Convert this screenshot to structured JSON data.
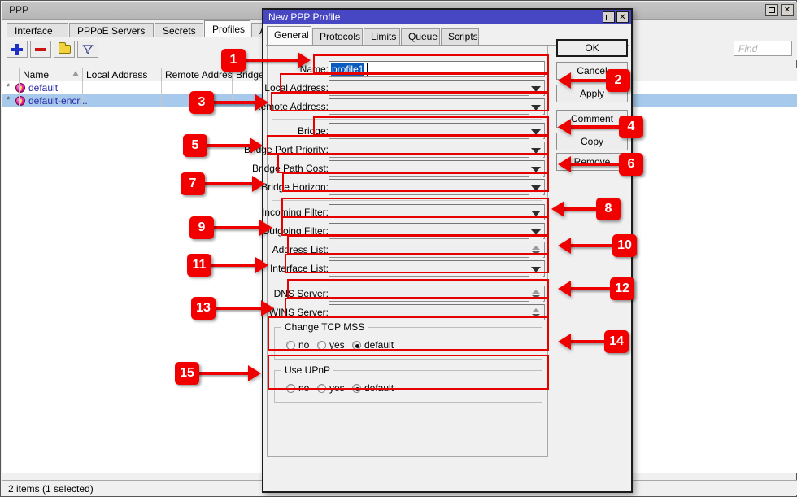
{
  "main_window": {
    "title": "PPP",
    "controls": {
      "maximize": "□",
      "close": "✕"
    },
    "tabs": [
      {
        "label": "Interface",
        "active": false
      },
      {
        "label": "PPPoE Servers",
        "active": false
      },
      {
        "label": "Secrets",
        "active": false
      },
      {
        "label": "Profiles",
        "active": true
      },
      {
        "label": "Active Connec",
        "active": false
      }
    ],
    "toolbar": [
      {
        "name": "add-button",
        "icon": "plus-icon"
      },
      {
        "name": "remove-button",
        "icon": "minus-icon"
      },
      {
        "name": "comment-button",
        "icon": "folder-icon"
      },
      {
        "name": "filter-button",
        "icon": "funnel-icon"
      }
    ],
    "find": {
      "placeholder": "Find",
      "value": ""
    },
    "list": {
      "columns": [
        "Name",
        "Local Address",
        "Remote Address",
        "Bridge"
      ],
      "rows": [
        {
          "flag": "*",
          "name": "default",
          "local_address": "",
          "remote_address": "",
          "bridge": "",
          "selected": false
        },
        {
          "flag": "*",
          "name": "default-encr...",
          "local_address": "",
          "remote_address": "",
          "bridge": "",
          "selected": true
        }
      ]
    },
    "status": "2 items (1 selected)"
  },
  "dialog": {
    "title": "New PPP Profile",
    "controls": {
      "maximize": "□",
      "close": "✕"
    },
    "tabs": [
      {
        "label": "General",
        "active": true
      },
      {
        "label": "Protocols",
        "active": false
      },
      {
        "label": "Limits",
        "active": false
      },
      {
        "label": "Queue",
        "active": false
      },
      {
        "label": "Scripts",
        "active": false
      }
    ],
    "fields": [
      {
        "label": "Name:",
        "value": "profile1",
        "selected_text": true,
        "control": "text"
      },
      {
        "label": "Local Address:",
        "value": "",
        "control": "dropdown"
      },
      {
        "label": "Remote Address:",
        "value": "",
        "control": "dropdown"
      },
      {
        "label": "Bridge:",
        "value": "",
        "control": "dropdown"
      },
      {
        "label": "Bridge Port Priority:",
        "value": "",
        "control": "dropdown"
      },
      {
        "label": "Bridge Path Cost:",
        "value": "",
        "control": "dropdown"
      },
      {
        "label": "Bridge Horizon:",
        "value": "",
        "control": "dropdown"
      },
      {
        "label": "Incoming Filter:",
        "value": "",
        "control": "dropdown"
      },
      {
        "label": "Outgoing Filter:",
        "value": "",
        "control": "dropdown"
      },
      {
        "label": "Address List:",
        "value": "",
        "control": "spinner"
      },
      {
        "label": "Interface List:",
        "value": "",
        "control": "dropdown"
      },
      {
        "label": "DNS Server:",
        "value": "",
        "control": "spinner"
      },
      {
        "label": "WINS Server:",
        "value": "",
        "control": "spinner"
      }
    ],
    "groups": [
      {
        "title": "Change TCP MSS",
        "options": [
          {
            "label": "no",
            "selected": false
          },
          {
            "label": "yes",
            "selected": false
          },
          {
            "label": "default",
            "selected": true
          }
        ]
      },
      {
        "title": "Use UPnP",
        "options": [
          {
            "label": "no",
            "selected": false
          },
          {
            "label": "yes",
            "selected": false
          },
          {
            "label": "default",
            "selected": true
          }
        ]
      }
    ],
    "buttons": [
      {
        "label": "OK",
        "default": true
      },
      {
        "label": "Cancel",
        "default": false
      },
      {
        "label": "Apply",
        "default": false
      },
      {
        "label": "Comment",
        "default": false
      },
      {
        "label": "Copy",
        "default": false
      },
      {
        "label": "Remove",
        "default": false
      }
    ]
  },
  "callouts": [
    {
      "number": "1",
      "target": "Name field"
    },
    {
      "number": "2",
      "target": "Apply button"
    },
    {
      "number": "3",
      "target": "Remote Address field"
    },
    {
      "number": "4",
      "target": "Copy button"
    },
    {
      "number": "5",
      "target": "Bridge Port Priority field"
    },
    {
      "number": "6",
      "target": "Remove button"
    },
    {
      "number": "7",
      "target": "Bridge Horizon field"
    },
    {
      "number": "8",
      "target": "Incoming Filter field"
    },
    {
      "number": "9",
      "target": "Outgoing Filter field"
    },
    {
      "number": "10",
      "target": "Address List field"
    },
    {
      "number": "11",
      "target": "Interface List field"
    },
    {
      "number": "12",
      "target": "DNS Server field"
    },
    {
      "number": "13",
      "target": "WINS Server field"
    },
    {
      "number": "14",
      "target": "Change TCP MSS group"
    },
    {
      "number": "15",
      "target": "Use UPnP group"
    }
  ],
  "colors": {
    "callout_red": "#f20000",
    "highlight_border": "#e60000",
    "dialog_titlebar": "#4747c4",
    "selection_blue": "#a6c9ec",
    "text_selection": "#0a5bbd"
  }
}
